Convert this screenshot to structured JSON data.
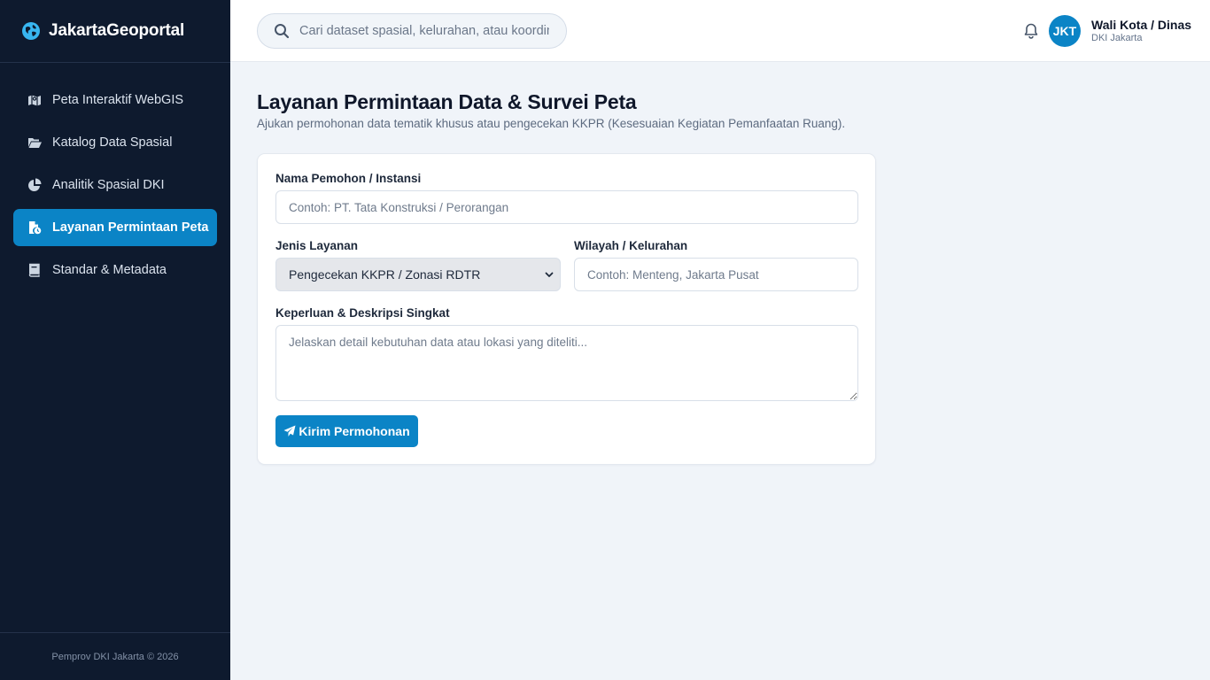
{
  "brand": {
    "name": "JakartaGeoportal",
    "icon": "globe-icon"
  },
  "sidebar": {
    "items": [
      {
        "label": "Peta Interaktif WebGIS",
        "icon": "map-icon",
        "active": false
      },
      {
        "label": "Katalog Data Spasial",
        "icon": "folder-open-icon",
        "active": false
      },
      {
        "label": "Analitik Spasial DKI",
        "icon": "pie-chart-icon",
        "active": false
      },
      {
        "label": "Layanan Permintaan Peta",
        "icon": "file-clock-icon",
        "active": true
      },
      {
        "label": "Standar & Metadata",
        "icon": "book-icon",
        "active": false
      }
    ],
    "footer": "Pemprov DKI Jakarta © 2026"
  },
  "header": {
    "search_placeholder": "Cari dataset spasial, kelurahan, atau koordinat...",
    "user": {
      "initials": "JKT",
      "name": "Wali Kota / Dinas",
      "org": "DKI Jakarta"
    }
  },
  "page": {
    "title": "Layanan Permintaan Data & Survei Peta",
    "subtitle": "Ajukan permohonan data tematik khusus atau pengecekan KKPR (Kesesuaian Kegiatan Pemanfaatan Ruang)."
  },
  "form": {
    "applicant_label": "Nama Pemohon / Instansi",
    "applicant_placeholder": "Contoh: PT. Tata Konstruksi / Perorangan",
    "service_label": "Jenis Layanan",
    "service_selected": "Pengecekan KKPR / Zonasi RDTR",
    "region_label": "Wilayah / Kelurahan",
    "region_placeholder": "Contoh: Menteng, Jakarta Pusat",
    "purpose_label": "Keperluan & Deskripsi Singkat",
    "purpose_placeholder": "Jelaskan detail kebutuhan data atau lokasi yang diteliti...",
    "submit_label": "Kirim Permohonan"
  },
  "colors": {
    "sidebar_bg": "#0e1a2e",
    "accent": "#0b84c6",
    "page_bg": "#f0f4f9"
  }
}
